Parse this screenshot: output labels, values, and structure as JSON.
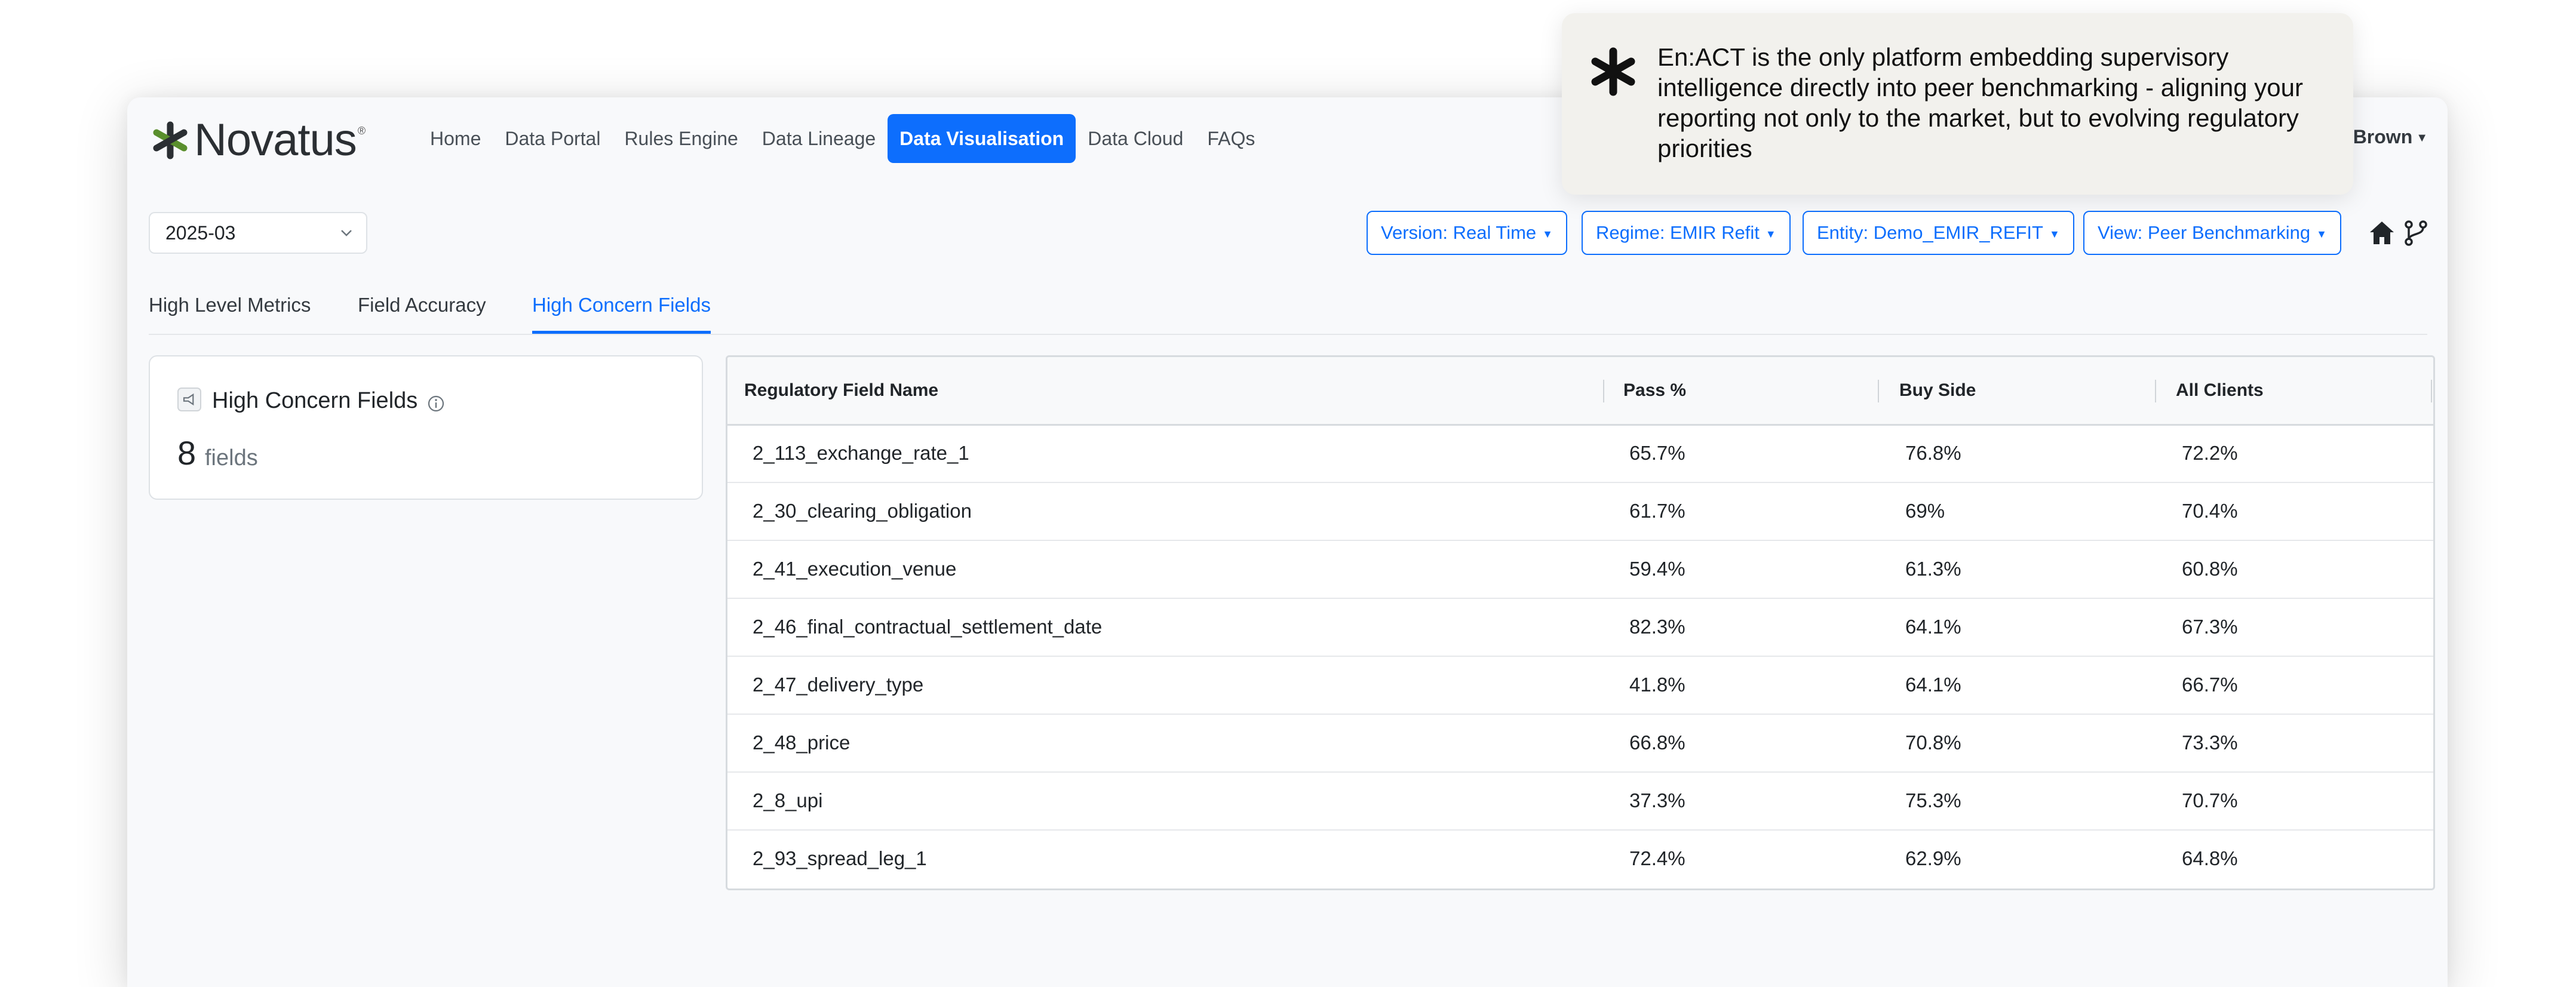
{
  "brand": {
    "name": "Novatus",
    "reg_mark": "®"
  },
  "nav": {
    "items": [
      {
        "label": "Home",
        "active": false
      },
      {
        "label": "Data Portal",
        "active": false
      },
      {
        "label": "Rules Engine",
        "active": false
      },
      {
        "label": "Data Lineage",
        "active": false
      },
      {
        "label": "Data Visualisation",
        "active": true
      },
      {
        "label": "Data Cloud",
        "active": false
      },
      {
        "label": "FAQs",
        "active": false
      }
    ]
  },
  "user": {
    "name": "k Brown"
  },
  "period_select": {
    "value": "2025-03"
  },
  "filters": {
    "version": "Version: Real Time",
    "regime": "Regime: EMIR Refit",
    "entity": "Entity: Demo_EMIR_REFIT",
    "view": "View: Peer Benchmarking"
  },
  "tabs": [
    {
      "label": "High Level Metrics",
      "active": false
    },
    {
      "label": "Field Accuracy",
      "active": false
    },
    {
      "label": "High Concern Fields",
      "active": true
    }
  ],
  "summary_card": {
    "title": "High Concern Fields",
    "count": "8",
    "unit": "fields"
  },
  "table": {
    "columns": [
      "Regulatory Field Name",
      "Pass %",
      "Buy Side",
      "All Clients"
    ],
    "rows": [
      [
        "2_113_exchange_rate_1",
        "65.7%",
        "76.8%",
        "72.2%"
      ],
      [
        "2_30_clearing_obligation",
        "61.7%",
        "69%",
        "70.4%"
      ],
      [
        "2_41_execution_venue",
        "59.4%",
        "61.3%",
        "60.8%"
      ],
      [
        "2_46_final_contractual_settlement_date",
        "82.3%",
        "64.1%",
        "67.3%"
      ],
      [
        "2_47_delivery_type",
        "41.8%",
        "64.1%",
        "66.7%"
      ],
      [
        "2_48_price",
        "66.8%",
        "70.8%",
        "73.3%"
      ],
      [
        "2_8_upi",
        "37.3%",
        "75.3%",
        "70.7%"
      ],
      [
        "2_93_spread_leg_1",
        "72.4%",
        "62.9%",
        "64.8%"
      ]
    ]
  },
  "toast": {
    "message": "En:ACT is the only platform embedding supervisory intelligence directly into peer benchmarking - aligning your reporting not only to the market, but to evolving regulatory priorities"
  },
  "colors": {
    "accent": "#0d6efd",
    "logo_green": "#5a8f2d",
    "logo_dark": "#2b2f33"
  },
  "icons": [
    "novatus-logo-icon",
    "chevron-down-icon",
    "caret-down-icon",
    "home-icon",
    "branch-icon",
    "megaphone-icon",
    "info-icon",
    "enact-star-icon"
  ]
}
